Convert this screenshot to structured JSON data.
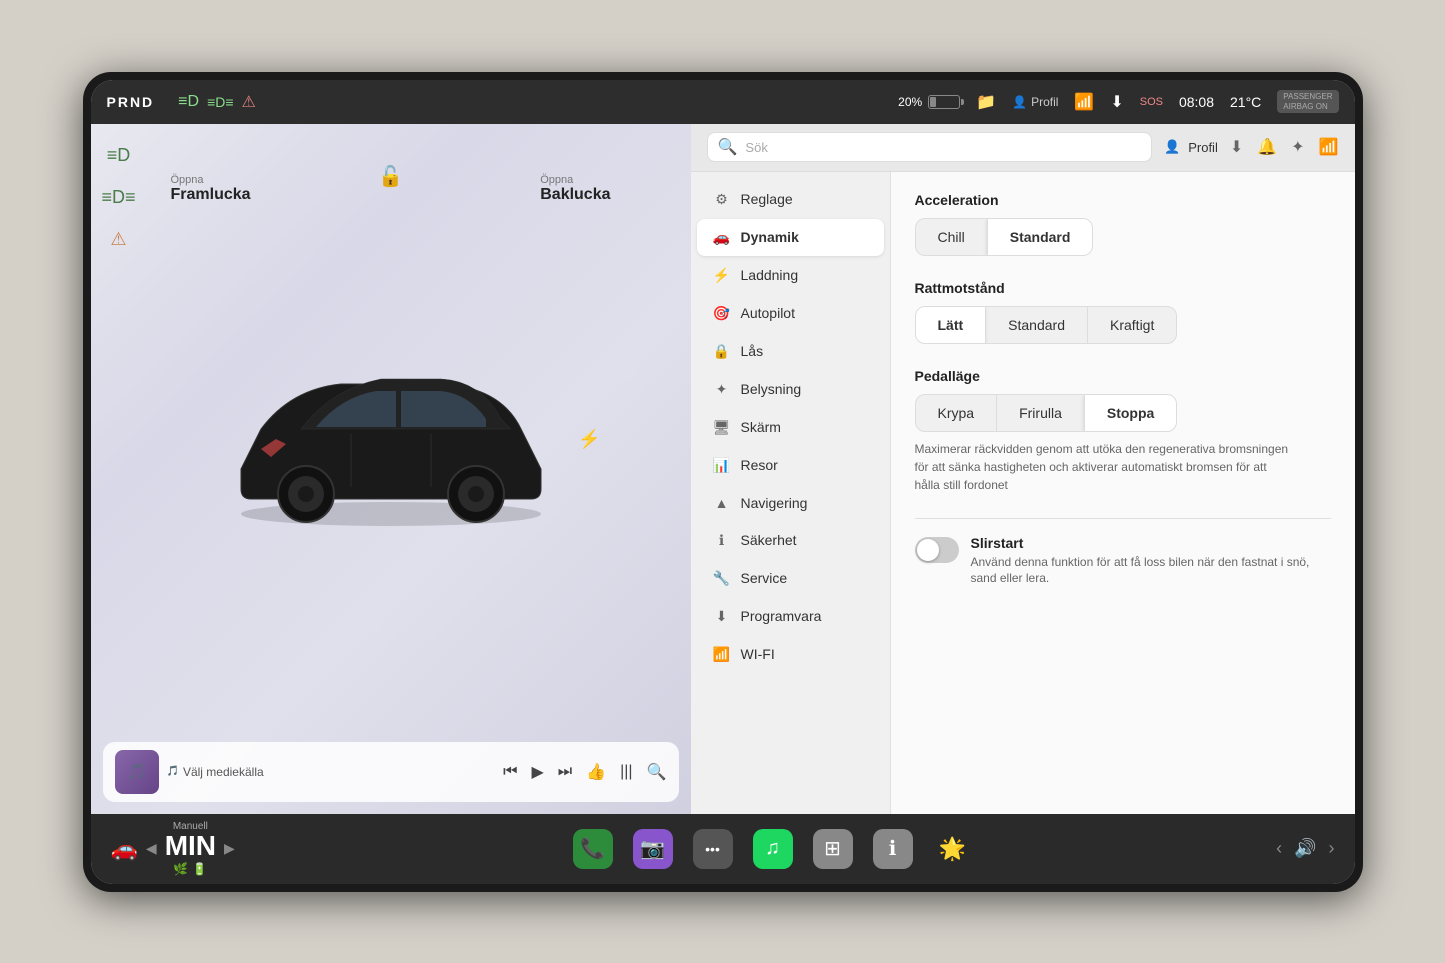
{
  "statusBar": {
    "prnd": "PRND",
    "battery_percent": "20%",
    "profile_label": "Profil",
    "wifi_icon": "wifi",
    "download_icon": "download",
    "sos_label": "SOS",
    "time": "08:08",
    "temperature": "21°C",
    "airbag_label": "PASSENGER\nAIRBAG ON"
  },
  "leftPanel": {
    "framlucka_prefix": "Öppna",
    "framlucka_name": "Framlucka",
    "baklucka_prefix": "Öppna",
    "baklucka_name": "Baklucka",
    "media_source_label": "Välj mediekälla"
  },
  "searchBar": {
    "placeholder": "Sök",
    "profile_label": "Profil"
  },
  "menu": {
    "items": [
      {
        "id": "reglage",
        "label": "Reglage",
        "icon": "⚙"
      },
      {
        "id": "dynamik",
        "label": "Dynamik",
        "icon": "🚗",
        "active": true
      },
      {
        "id": "laddning",
        "label": "Laddning",
        "icon": "⚡"
      },
      {
        "id": "autopilot",
        "label": "Autopilot",
        "icon": "🎯"
      },
      {
        "id": "las",
        "label": "Lås",
        "icon": "🔒"
      },
      {
        "id": "belysning",
        "label": "Belysning",
        "icon": "✦"
      },
      {
        "id": "skarm",
        "label": "Skärm",
        "icon": "🖥"
      },
      {
        "id": "resor",
        "label": "Resor",
        "icon": "📊"
      },
      {
        "id": "navigering",
        "label": "Navigering",
        "icon": "▲"
      },
      {
        "id": "sakerhet",
        "label": "Säkerhet",
        "icon": "ℹ"
      },
      {
        "id": "service",
        "label": "Service",
        "icon": "🔧"
      },
      {
        "id": "programvara",
        "label": "Programvara",
        "icon": "⬇"
      },
      {
        "id": "wifi",
        "label": "WI-FI",
        "icon": "📶"
      }
    ]
  },
  "dynamikSettings": {
    "acceleration": {
      "title": "Acceleration",
      "options": [
        {
          "id": "chill",
          "label": "Chill",
          "selected": false
        },
        {
          "id": "standard",
          "label": "Standard",
          "selected": true
        }
      ]
    },
    "rattmotstand": {
      "title": "Rattmotstånd",
      "options": [
        {
          "id": "latt",
          "label": "Lätt",
          "selected": true
        },
        {
          "id": "standard",
          "label": "Standard",
          "selected": false
        },
        {
          "id": "kraftigt",
          "label": "Kraftigt",
          "selected": false
        }
      ]
    },
    "pedalage": {
      "title": "Pedalläge",
      "options": [
        {
          "id": "krypa",
          "label": "Krypa",
          "selected": false
        },
        {
          "id": "frirulla",
          "label": "Frirulla",
          "selected": false
        },
        {
          "id": "stoppa",
          "label": "Stoppa",
          "selected": true
        }
      ],
      "description": "Maximerar räckvidden genom att utöka den regenerativa bromsningen för att sänka hastigheten och aktiverar automatiskt bromsen för att hålla still fordonet"
    },
    "slirstart": {
      "title": "Slirstart",
      "toggle": false,
      "description": "Använd denna funktion för att få loss bilen när den fastnat i snö, sand eller lera."
    }
  },
  "taskbar": {
    "gear_label": "Manuell",
    "gear_value": "MIN",
    "apps": [
      {
        "id": "phone",
        "label": "📞"
      },
      {
        "id": "camera",
        "label": "📷"
      },
      {
        "id": "dots",
        "label": "···"
      },
      {
        "id": "spotify",
        "label": "♫"
      },
      {
        "id": "calc",
        "label": "⊞"
      },
      {
        "id": "info",
        "label": "ℹ"
      },
      {
        "id": "multi",
        "label": "🌟"
      }
    ],
    "volume_icon": "🔊"
  }
}
